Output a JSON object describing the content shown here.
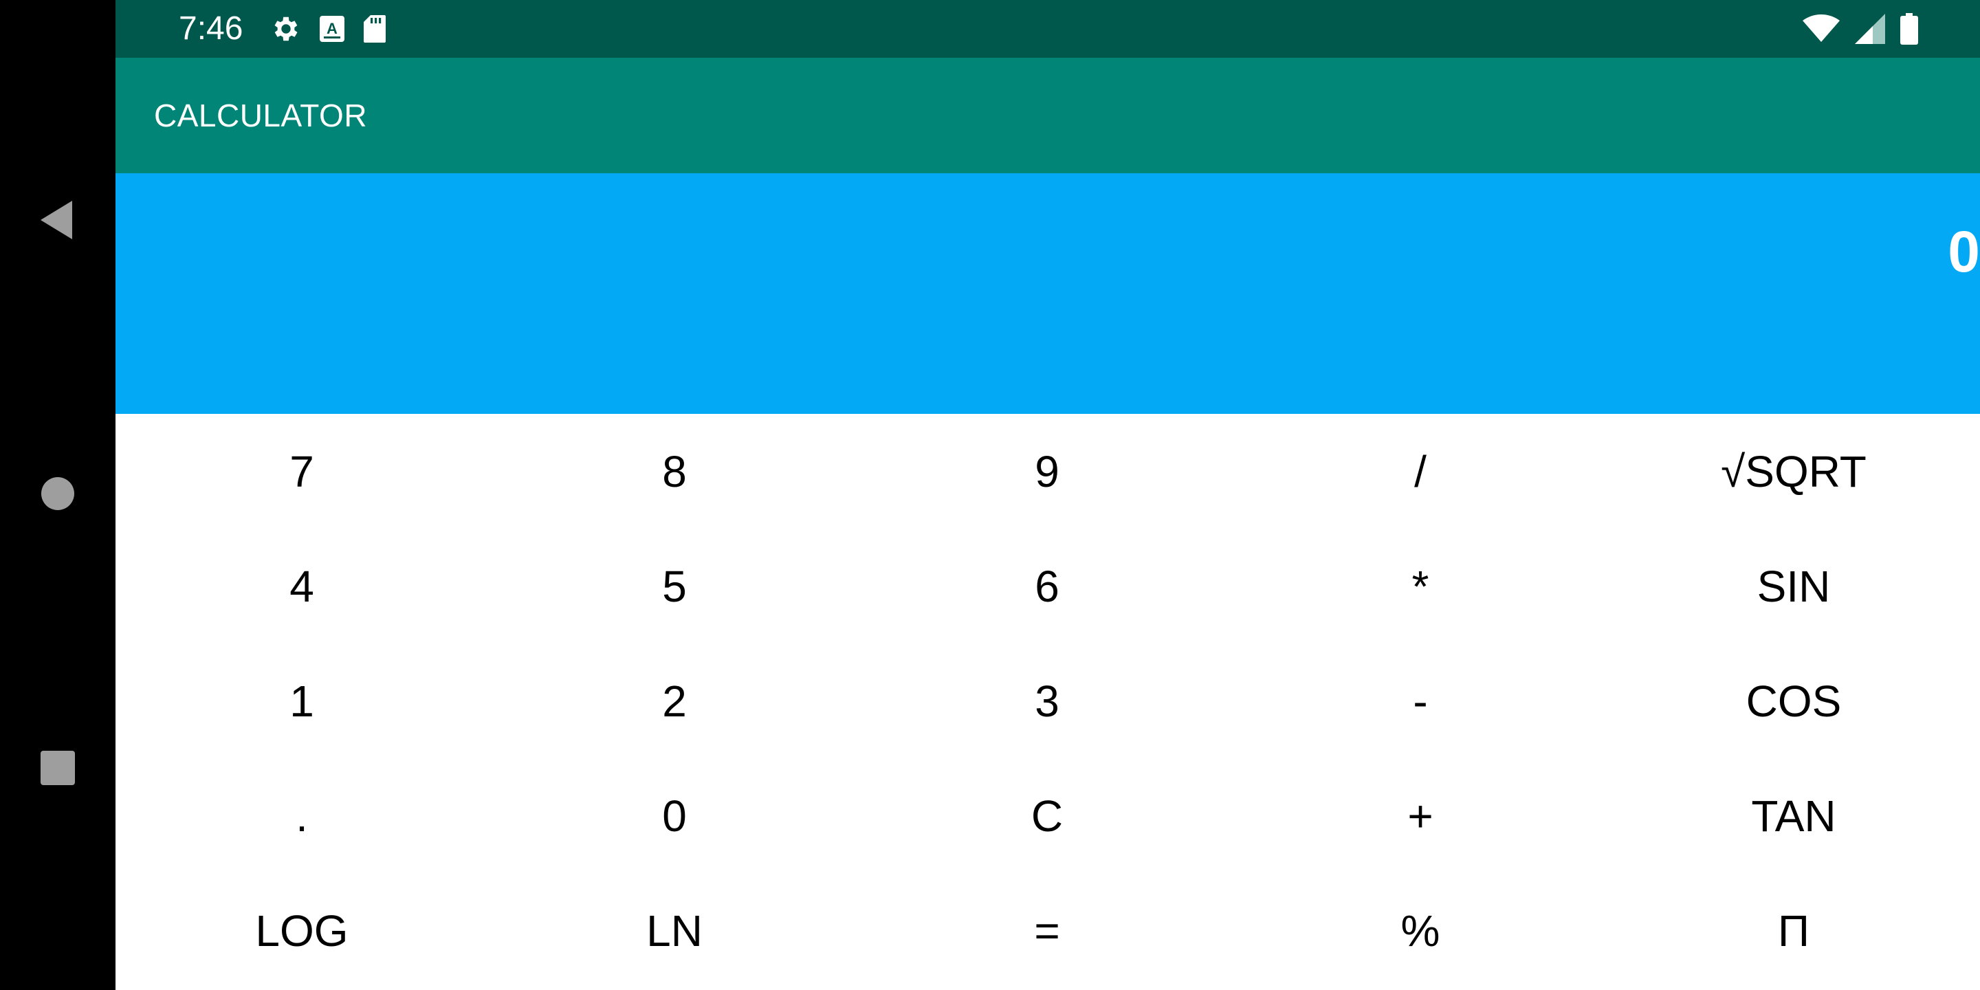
{
  "status_bar": {
    "time": "7:46",
    "left_icons": [
      "settings-icon",
      "a-notification-icon",
      "sd-card-icon"
    ],
    "right_icons": [
      "wifi-icon",
      "cell-signal-icon",
      "battery-icon"
    ]
  },
  "navigation": {
    "back": "back-icon",
    "home": "home-icon",
    "recents": "recents-icon"
  },
  "app_bar": {
    "title": "CALCULATOR"
  },
  "display": {
    "value": "0"
  },
  "keypad": {
    "rows": [
      [
        "7",
        "8",
        "9",
        "/",
        "√SQRT"
      ],
      [
        "4",
        "5",
        "6",
        "*",
        "SIN"
      ],
      [
        "1",
        "2",
        "3",
        "-",
        "COS"
      ],
      [
        ".",
        "0",
        "C",
        "+",
        "TAN"
      ],
      [
        "LOG",
        "LN",
        "=",
        "%",
        "Π"
      ]
    ]
  },
  "colors": {
    "status_bar": "#00574b",
    "app_bar": "#008577",
    "display": "#03a9f4",
    "nav_bar": "#000000"
  }
}
